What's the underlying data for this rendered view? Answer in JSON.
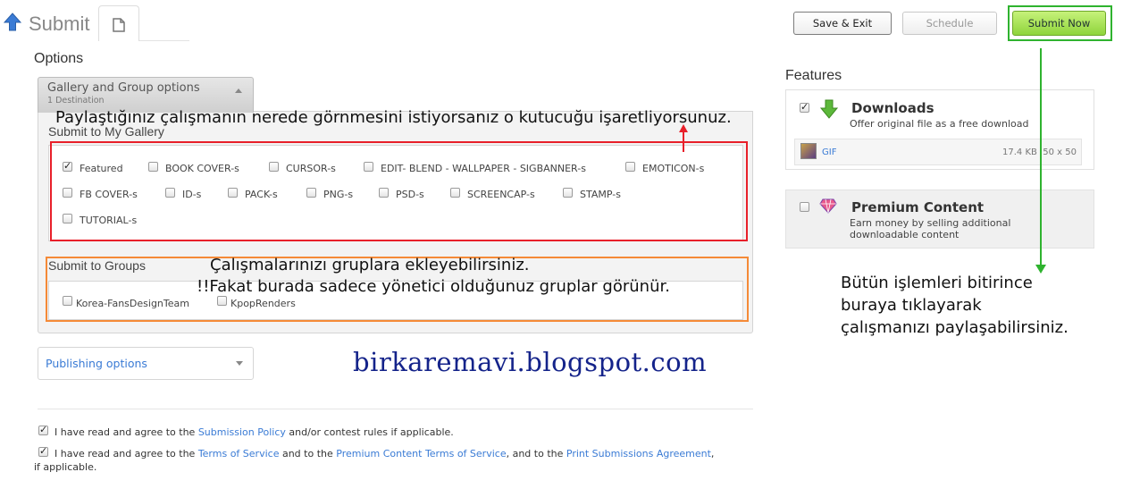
{
  "header": {
    "title": "Submit",
    "buttons": {
      "save_exit": "Save & Exit",
      "schedule": "Schedule",
      "submit_now": "Submit Now"
    }
  },
  "options": {
    "title": "Options",
    "gallery_group": {
      "title": "Gallery and Group options",
      "subtitle": "1 Destination"
    },
    "submit_gallery": {
      "label": "Submit to My Gallery",
      "items": [
        {
          "label": "Featured",
          "checked": true
        },
        {
          "label": "BOOK COVER-s",
          "checked": false
        },
        {
          "label": "CURSOR-s",
          "checked": false
        },
        {
          "label": "EDIT- BLEND - WALLPAPER - SIGBANNER-s",
          "checked": false
        },
        {
          "label": "EMOTICON-s",
          "checked": false
        },
        {
          "label": "FB COVER-s",
          "checked": false
        },
        {
          "label": "ID-s",
          "checked": false
        },
        {
          "label": "PACK-s",
          "checked": false
        },
        {
          "label": "PNG-s",
          "checked": false
        },
        {
          "label": "PSD-s",
          "checked": false
        },
        {
          "label": "SCREENCAP-s",
          "checked": false
        },
        {
          "label": "STAMP-s",
          "checked": false
        },
        {
          "label": "TUTORIAL-s",
          "checked": false
        }
      ]
    },
    "submit_groups": {
      "label": "Submit to Groups",
      "items": [
        {
          "label": "Korea-FansDesignTeam",
          "checked": false
        },
        {
          "label": "KpopRenders",
          "checked": false
        }
      ]
    },
    "publishing_options": "Publishing options"
  },
  "agreements": {
    "line1_pre": "I have read and agree to the ",
    "line1_link": "Submission Policy",
    "line1_post": " and/or contest rules if applicable.",
    "line2_pre": "I have read and agree to the ",
    "line2_link1": "Terms of Service",
    "line2_mid1": " and to the ",
    "line2_link2": "Premium Content Terms of Service",
    "line2_mid2": ", and to the ",
    "line2_link3": "Print Submissions Agreement",
    "line2_post": ",",
    "line3": "if applicable."
  },
  "features": {
    "title": "Features",
    "downloads": {
      "title": "Downloads",
      "desc": "Offer original file as a free download",
      "file_type": "GIF",
      "file_info": "17.4 KB  50 x 50",
      "checked": true
    },
    "premium": {
      "title": "Premium Content",
      "desc_line1": "Earn money by selling additional",
      "desc_line2": "downloadable content",
      "checked": false
    }
  },
  "annotations": {
    "gallery_note": "Paylaştığınız çalışmanın nerede görnmesini istiyorsanız o kutucuğu işaretliyorsunuz.",
    "groups_note1": "Çalışmalarınızı gruplara ekleyebilirsiniz.",
    "groups_note2": "!!Fakat burada sadece yönetici olduğunuz gruplar görünür.",
    "blog": "birkaremavi.blogspot.com",
    "submit_note1": "Bütün işlemleri bitirince",
    "submit_note2": "buraya tıklayarak",
    "submit_note3": "çalışmanızı paylaşabilirsiniz."
  },
  "colors": {
    "link": "#3a7bd5",
    "annotation_red": "#e8202a",
    "annotation_orange": "#f58a37",
    "annotation_green": "#2fb32f",
    "submit_green": "#8fd43c",
    "blog_blue": "#14238a"
  }
}
